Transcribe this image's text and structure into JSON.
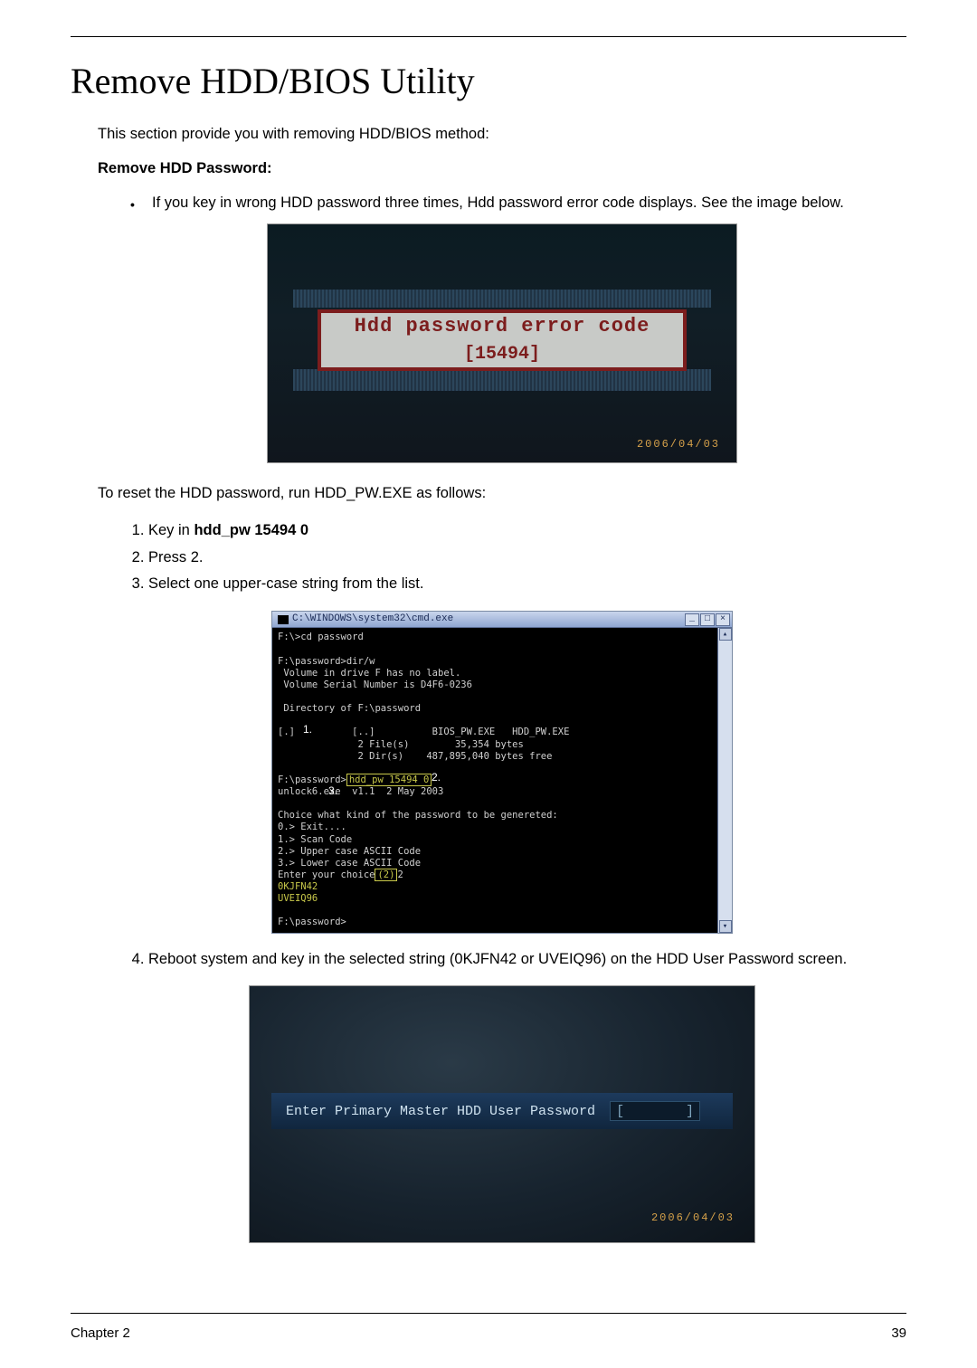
{
  "title": "Remove HDD/BIOS Utility",
  "intro": "This section provide you with removing HDD/BIOS method:",
  "sub1": "Remove HDD Password:",
  "bullet1": "If you key in wrong HDD password three times, Hdd password error code displays. See the image below.",
  "fig1": {
    "line1": "Hdd password error code",
    "line2": "[15494]",
    "date": "2006/04/03"
  },
  "reset_line": "To reset the HDD password, run HDD_PW.EXE as follows:",
  "steps_a": {
    "n1_pre": "Key in ",
    "n1_bold": "hdd_pw 15494 0",
    "n2": "Press 2.",
    "n3": "Select one upper-case string from the list."
  },
  "cmd": {
    "title": "C:\\WINDOWS\\system32\\cmd.exe",
    "min": "_",
    "max": "□",
    "close": "×",
    "scroll_up": "▴",
    "scroll_dn": "▾",
    "l00": "F:\\>cd password",
    "l01": "",
    "l02": "F:\\password>dir/w",
    "l03": " Volume in drive F has no label.",
    "l04": " Volume Serial Number is D4F6-0236",
    "l05": "",
    "l06": " Directory of F:\\password",
    "l07": "",
    "l08": "[.]          [..]          BIOS_PW.EXE   HDD_PW.EXE",
    "l09": "              2 File(s)        35,354 bytes",
    "l10": "              2 Dir(s)    487,895,040 bytes free",
    "l11": "",
    "l12a": "F:\\password>",
    "l12b": "hdd_pw 15494 0",
    "l13": "unlock6.exe  v1.1  2 May 2003",
    "l14": "",
    "l15": "Choice what kind of the password to be genereted:",
    "l16": "0.> Exit....",
    "l17": "1.> Scan Code",
    "l18": "2.> Upper case ASCII Code",
    "l19": "3.> Lower case ASCII Code",
    "l20a": "Enter your choice",
    "l20b": "(2)",
    "l20c": "2",
    "l21": "0KJFN42",
    "l22": "UVEIQ96",
    "l23": "",
    "l24": "F:\\password>",
    "an1": "1.",
    "an2": "2.",
    "an3": "3."
  },
  "steps_b": {
    "n4": "Reboot system and key in the selected string (0KJFN42 or UVEIQ96) on the HDD User Password screen."
  },
  "fig3": {
    "label": "Enter Primary Master HDD User Password",
    "lbr": "[",
    "rbr": "]",
    "date": "2006/04/03"
  },
  "footer": {
    "left": "Chapter 2",
    "right": "39"
  }
}
